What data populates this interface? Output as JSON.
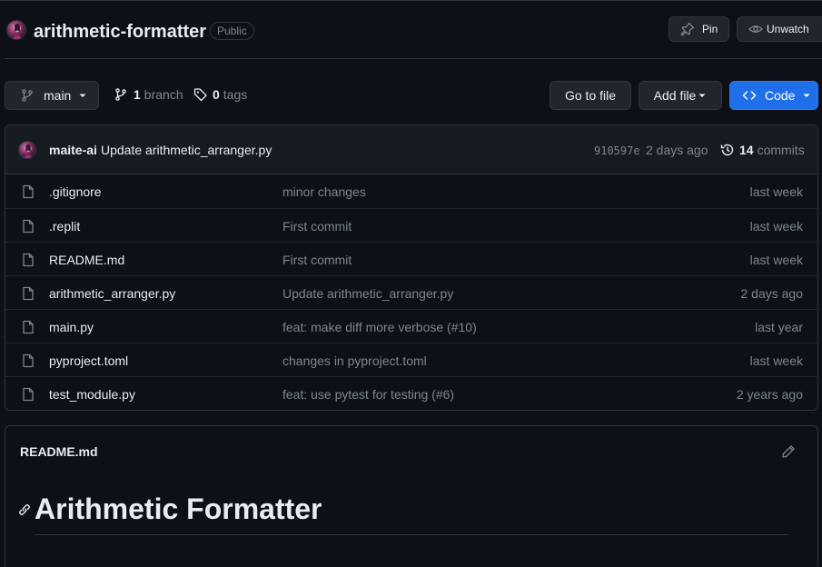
{
  "repo": {
    "name": "arithmetic-formatter",
    "visibility": "Public"
  },
  "header_actions": {
    "pin_label": "Pin",
    "unwatch_label": "Unwatch"
  },
  "toolbar": {
    "branch": "main",
    "branch_count": "1",
    "branch_word": "branch",
    "tag_count": "0",
    "tag_word": "tags",
    "go_to_file": "Go to file",
    "add_file": "Add file",
    "code": "Code"
  },
  "latest_commit": {
    "author": "maite-ai",
    "message": "Update arithmetic_arranger.py",
    "sha": "910597e",
    "age": "2 days ago",
    "commit_count": "14",
    "commit_word": "commits"
  },
  "files": [
    {
      "name": ".gitignore",
      "message": "minor changes",
      "age": "last week"
    },
    {
      "name": ".replit",
      "message": "First commit",
      "age": "last week"
    },
    {
      "name": "README.md",
      "message": "First commit",
      "age": "last week"
    },
    {
      "name": "arithmetic_arranger.py",
      "message": "Update arithmetic_arranger.py",
      "age": "2 days ago"
    },
    {
      "name": "main.py",
      "message": "feat: make diff more verbose (#10)",
      "age": "last year"
    },
    {
      "name": "pyproject.toml",
      "message": "changes in pyproject.toml",
      "age": "last week"
    },
    {
      "name": "test_module.py",
      "message": "feat: use pytest for testing (#6)",
      "age": "2 years ago"
    }
  ],
  "readme": {
    "filename": "README.md",
    "heading": "Arithmetic Formatter"
  },
  "colors": {
    "background": "#0d1117",
    "accent_blue": "#1f6feb",
    "muted_text": "#7d8590",
    "border": "#30363d"
  }
}
